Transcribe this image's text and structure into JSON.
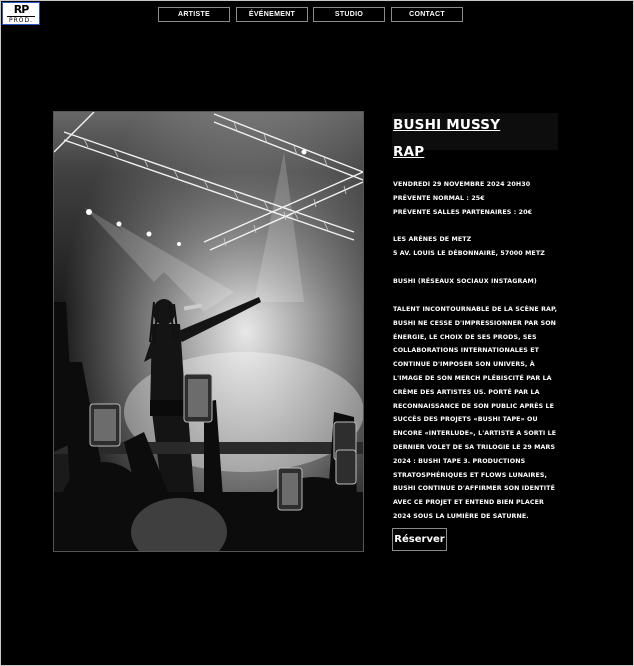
{
  "logo": {
    "line1": "RP",
    "line2": "PROD."
  },
  "nav": [
    "ARTISTE",
    "ÉVÉNEMENT",
    "STUDIO",
    "CONTACT"
  ],
  "event": {
    "artist": "BUSHI MUSSY",
    "genre": "RAP",
    "date": "VENDREDI 29 NOVEMBRE 2024  20H30",
    "price_normal": "PRÉVENTE NORMAL : 25€",
    "price_partners": "PRÉVENTE SALLES PARTENAIRES : 20€",
    "venue": "LES ARÈNES DE METZ",
    "address": "5 AV. LOUIS LE DÉBONNAIRE, 57000 METZ",
    "social": "BUSHI (RÉSEAUX SOCIAUX INSTAGRAM)",
    "description": "TALENT INCONTOURNABLE DE LA SCÈNE RAP, BUSHI NE CESSE D'IMPRESSIONNER PAR SON ÉNERGIE, LE CHOIX DE SES PRODS, SES COLLABORATIONS INTERNATIONALES ET CONTINUE D'IMPOSER SON UNIVERS, À L'IMAGE DE SON MERCH PLÉBISCITÉ PAR LA CRÈME DES ARTISTES US. PORTÉ PAR LA RECONNAISSANCE DE SON PUBLIC APRÈS LE SUCCÈS DES PROJETS «BUSHI TAPE» OU ENCORE «INTERLUDE», L'ARTISTE A SORTI LE DERNIER VOLET DE SA TRILOGIE LE 29 MARS 2024 : BUSHI TAPE 3. PRODUCTIONS STRATOSPHÉRIQUES ET FLOWS LUNAIRES, BUSHI CONTINUE D'AFFIRMER SON IDENTITÉ AVEC CE PROJET ET ENTEND BIEN PLACER 2024 SOUS LA LUMIÈRE DE SATURNE."
  },
  "reserve_label": "Réserver"
}
